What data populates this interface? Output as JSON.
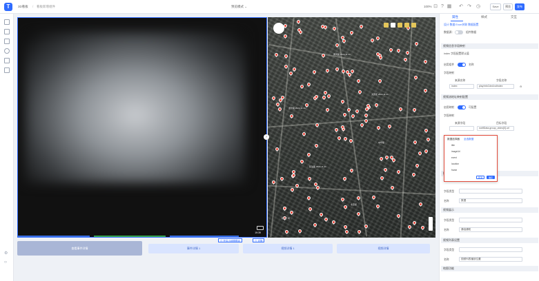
{
  "topbar": {
    "logo_text": "T",
    "crumb_1": "3D看板",
    "crumb_sep": "/",
    "crumb_2": "看板新增组件",
    "center_text": "预览模式 ⌄",
    "zoom": "100%",
    "btn_save": "Save",
    "btn_preview": "预览",
    "btn_publish": "发布"
  },
  "video": {
    "timestamp": "19:39"
  },
  "tags": {
    "tag_1": "⊙ 开启小地图联动",
    "tag_2": "⊙ 切换"
  },
  "cards": {
    "main": "查看事件详情",
    "card_2": "事件详情 1",
    "card_3": "视频详情 1",
    "card_4": "视频详情"
  },
  "map": {
    "labels": [
      "黄河路 2022-11-11",
      "龙华路 2022-11-11",
      "太原街 2022-11-11",
      "民生路 2022-11-11",
      "中华路",
      "北京街",
      "和平广场"
    ]
  },
  "panel": {
    "tabs": [
      "属性",
      "样式",
      "交互"
    ],
    "subtabs": "设计 数据 Excel关联 数据配置",
    "data_source_label": "数据源：",
    "data_source_value": "组件数据",
    "section_1": "视频信息字段映射",
    "section_1_sub": "index 字段配置默认值",
    "enable_label": "启用组件",
    "enable_hint": "名称",
    "field_label": "字段映射",
    "col_source": "来源名称",
    "col_target": "字段名称",
    "row1_a": "index",
    "row1_b": "playInfoCdnAndIndex",
    "section_2": "视频流地址映射配置",
    "enable_label_2": "启用映射",
    "enable_hint_2": "可配置",
    "field_label_2": "字段映射",
    "col_source_2": "来源字段",
    "col_target_2": "目标字段",
    "row2_a": "",
    "row2_b": "notifData.group_video[0].url",
    "section_3": "播放设置",
    "f_label_1": "字段类型",
    "f_val_1": "",
    "f_label_2": "名称",
    "f_val_2": "数据",
    "section_4": "视频展示",
    "f_label_3": "字段类型",
    "f_val_3": "",
    "f_label_4": "名称",
    "f_val_4": "通话通知",
    "section_5": "视频列表设置",
    "f_label_5": "字段类型",
    "f_val_5": "",
    "f_label_6": "名称",
    "f_val_6": "视频列表播放位置",
    "section_6": "地图功能"
  },
  "popup": {
    "title": "数据选择器",
    "link": "全选数据",
    "options": [
      "title",
      "imageUrl",
      "event",
      "location",
      "frame"
    ],
    "cancel": "取消",
    "confirm": "确定"
  },
  "colors": {
    "accent": "#2f6bff",
    "pin": "#e8473a",
    "popup_border": "#e24a3a"
  }
}
